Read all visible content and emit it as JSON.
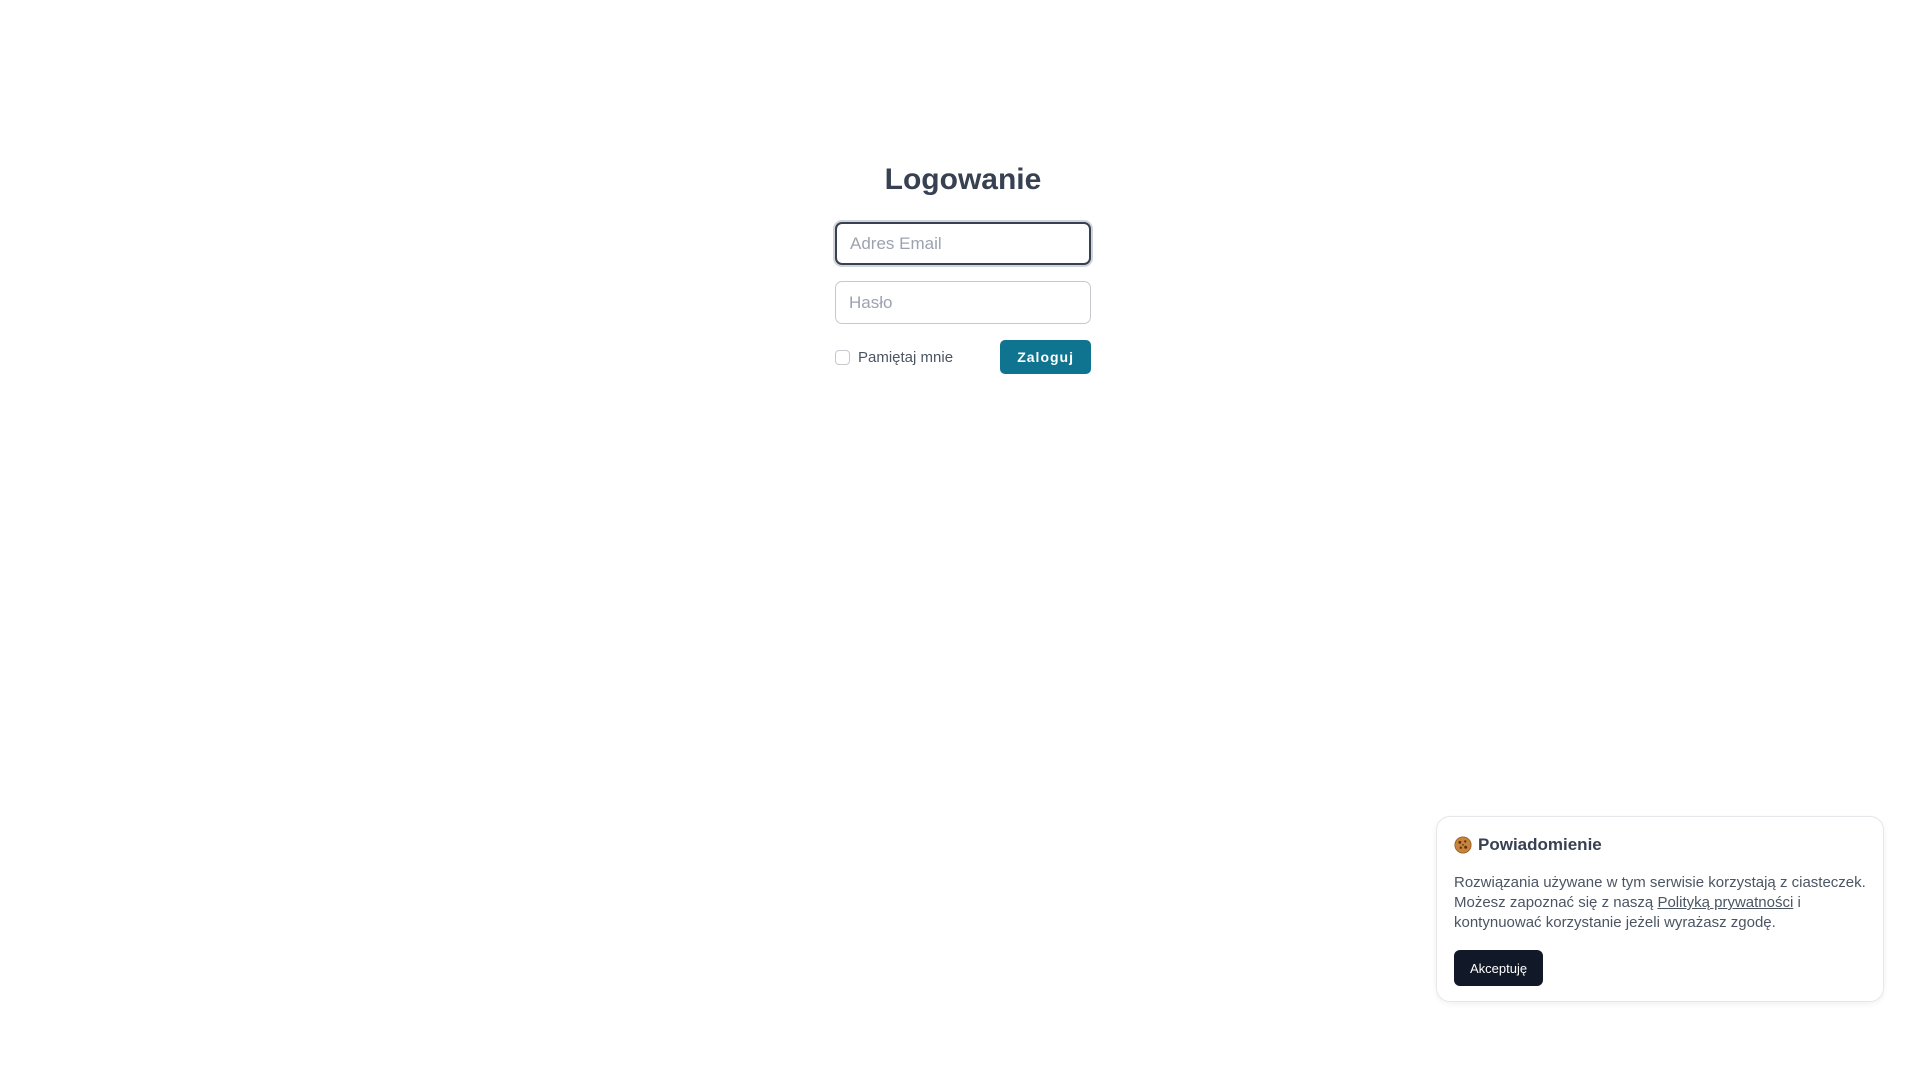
{
  "login": {
    "title": "Logowanie",
    "email_placeholder": "Adres Email",
    "email_value": "",
    "password_placeholder": "Hasło",
    "password_value": "",
    "remember_label": "Pamiętaj mnie",
    "remember_checked": false,
    "submit_label": "Zaloguj"
  },
  "cookie": {
    "icon": "cookie-icon",
    "title": "Powiadomienie",
    "text_line1": "Rozwiązania używane w tym serwisie korzystają z ciasteczek.",
    "text_line2_start": "Możesz zapoznać się z naszą ",
    "policy_link": "Polityką prywatności",
    "text_line2_end": " i kontynuować korzystanie jeżeli wyrażasz zgodę.",
    "accept_label": "Akceptuję"
  },
  "colors": {
    "primary_button": "#0e7490",
    "accept_button": "#111827",
    "text": "#374151"
  }
}
